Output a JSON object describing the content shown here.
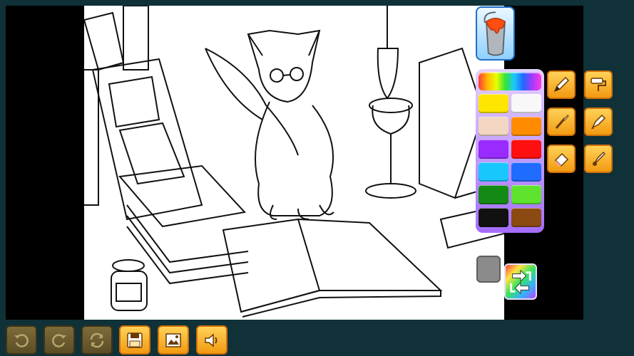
{
  "app": {
    "name": ""
  },
  "colors": {
    "background": "#0f3137",
    "stage": "#000000",
    "canvas": "#ffffff",
    "tool_accent": "#f29a12",
    "palette_frame": "#a46dff"
  },
  "tools": {
    "fill": {
      "icon": "paint-bucket-icon",
      "selected": true
    },
    "pencil": {
      "icon": "pencil-icon"
    },
    "roller": {
      "icon": "paint-roller-icon"
    },
    "brush": {
      "icon": "brush-icon"
    },
    "marker": {
      "icon": "marker-icon"
    },
    "eraser": {
      "icon": "eraser-icon"
    },
    "stamp": {
      "icon": "stamp-icon"
    }
  },
  "palette": {
    "rainbow": "custom-color-picker",
    "swatches": [
      "#ffe600",
      "#f8f8f8",
      "#f2d6c1",
      "#ff8c00",
      "#9a2bff",
      "#ff1010",
      "#19c7ff",
      "#1f6cff",
      "#138a13",
      "#5fe32e",
      "#111111",
      "#8a4a12"
    ]
  },
  "current_color": "#8b8b8b",
  "bottom_toolbar": [
    {
      "name": "undo-button",
      "icon": "undo-icon",
      "enabled": false
    },
    {
      "name": "redo-button",
      "icon": "redo-icon",
      "enabled": false
    },
    {
      "name": "reset-button",
      "icon": "refresh-icon",
      "enabled": false
    },
    {
      "name": "save-button",
      "icon": "floppy-disk-icon",
      "enabled": true
    },
    {
      "name": "gallery-button",
      "icon": "picture-icon",
      "enabled": true
    },
    {
      "name": "sound-button",
      "icon": "speaker-icon",
      "enabled": true
    }
  ]
}
